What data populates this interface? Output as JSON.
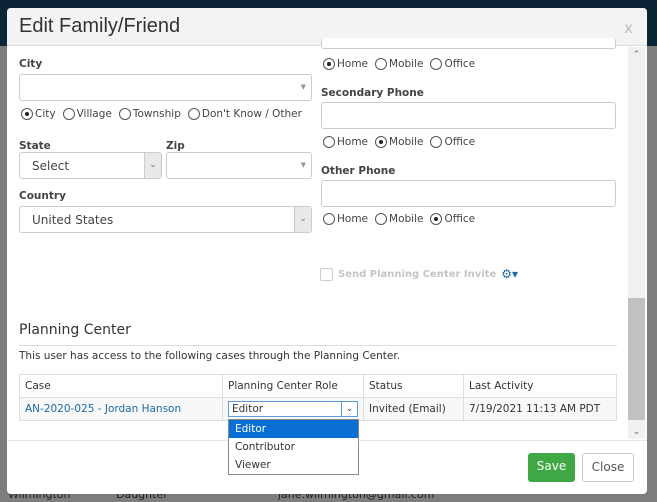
{
  "modal": {
    "title": "Edit Family/Friend",
    "close": "x"
  },
  "address": {
    "city_label": "City",
    "city_value": "",
    "city_types": [
      {
        "label": "City",
        "checked": true
      },
      {
        "label": "Village",
        "checked": false
      },
      {
        "label": "Township",
        "checked": false
      },
      {
        "label": "Don't Know / Other",
        "checked": false
      }
    ],
    "state_label": "State",
    "state_value": "Select",
    "zip_label": "Zip",
    "zip_value": "",
    "country_label": "Country",
    "country_value": "United States"
  },
  "phones": {
    "primary_types": [
      {
        "label": "Home",
        "checked": true
      },
      {
        "label": "Mobile",
        "checked": false
      },
      {
        "label": "Office",
        "checked": false
      }
    ],
    "secondary_label": "Secondary Phone",
    "secondary_types": [
      {
        "label": "Home",
        "checked": false
      },
      {
        "label": "Mobile",
        "checked": true
      },
      {
        "label": "Office",
        "checked": false
      }
    ],
    "other_label": "Other Phone",
    "other_types": [
      {
        "label": "Home",
        "checked": false
      },
      {
        "label": "Mobile",
        "checked": false
      },
      {
        "label": "Office",
        "checked": true
      }
    ],
    "invite_label": "Send Planning Center Invite"
  },
  "planning": {
    "heading": "Planning Center",
    "description": "This user has access to the following cases through the Planning Center.",
    "columns": [
      "Case",
      "Planning Center Role",
      "Status",
      "Last Activity"
    ],
    "row": {
      "case": "AN-2020-025 - Jordan Hanson",
      "role": "Editor",
      "status": "Invited (Email)",
      "last_activity": "7/19/2021 11:13 AM PDT"
    },
    "role_options": [
      "Editor",
      "Contributor",
      "Viewer"
    ]
  },
  "footer": {
    "save": "Save",
    "close": "Close"
  },
  "background": {
    "row": [
      "Wilmington",
      "Daughter",
      "jane.wilmington@gmail.com"
    ]
  },
  "colors": {
    "save": "#3fa844",
    "link": "#1c6aa8",
    "highlight": "#0a6fd4"
  }
}
